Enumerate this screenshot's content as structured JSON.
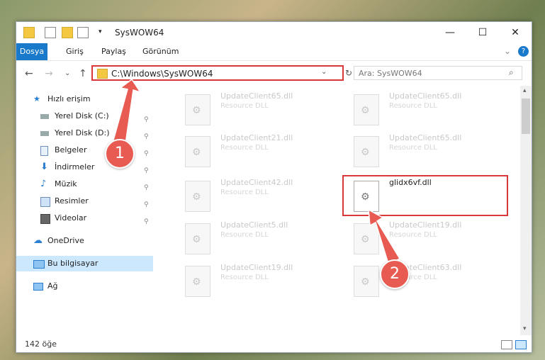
{
  "window": {
    "title": "SysWOW64",
    "controls": {
      "minimize": "—",
      "maximize": "☐",
      "close": "✕"
    }
  },
  "ribbon": {
    "tabs": [
      {
        "label": "Dosya",
        "active": true
      },
      {
        "label": "Giriş"
      },
      {
        "label": "Paylaş"
      },
      {
        "label": "Görünüm"
      }
    ],
    "help": "?"
  },
  "address_bar": {
    "path": "C:\\Windows\\SysWOW64",
    "search_placeholder": "Ara: SysWOW64"
  },
  "sidebar": {
    "items": [
      {
        "label": "Hızlı erişim",
        "icon": "star-icon"
      },
      {
        "label": "Yerel Disk (C:)",
        "icon": "drive-icon"
      },
      {
        "label": "Yerel Disk (D:)",
        "icon": "drive-icon"
      },
      {
        "label": "Belgeler",
        "icon": "documents-icon"
      },
      {
        "label": "İndirmeler",
        "icon": "download-icon"
      },
      {
        "label": "Müzik",
        "icon": "music-icon"
      },
      {
        "label": "Resimler",
        "icon": "pictures-icon"
      },
      {
        "label": "Videolar",
        "icon": "video-icon"
      },
      {
        "label": "OneDrive",
        "icon": "cloud-icon"
      },
      {
        "label": "Bu bilgisayar",
        "icon": "computer-icon"
      },
      {
        "label": "Ağ",
        "icon": "network-icon"
      }
    ]
  },
  "files": [
    {
      "name": "UpdateClient65.dll",
      "desc": "Resource DLL"
    },
    {
      "name": "UpdateClient65.dll",
      "desc": "Resource DLL"
    },
    {
      "name": "UpdateClient21.dll",
      "desc": "Resource DLL"
    },
    {
      "name": "UpdateClient65.dll",
      "desc": "Resource DLL"
    },
    {
      "name": "UpdateClient42.dll",
      "desc": "Resource DLL"
    },
    {
      "name": "glidx6vf.dll",
      "desc": ""
    },
    {
      "name": "UpdateClient5.dll",
      "desc": "Resource DLL"
    },
    {
      "name": "UpdateClient19.dll",
      "desc": "Resource DLL"
    },
    {
      "name": "UpdateClient19.dll",
      "desc": "Resource DLL"
    },
    {
      "name": "UpdateClient63.dll",
      "desc": "Resource DLL"
    }
  ],
  "status": {
    "count": "142 öğe"
  },
  "annotations": {
    "step1": "1",
    "step2": "2",
    "color": "#e85b52"
  }
}
